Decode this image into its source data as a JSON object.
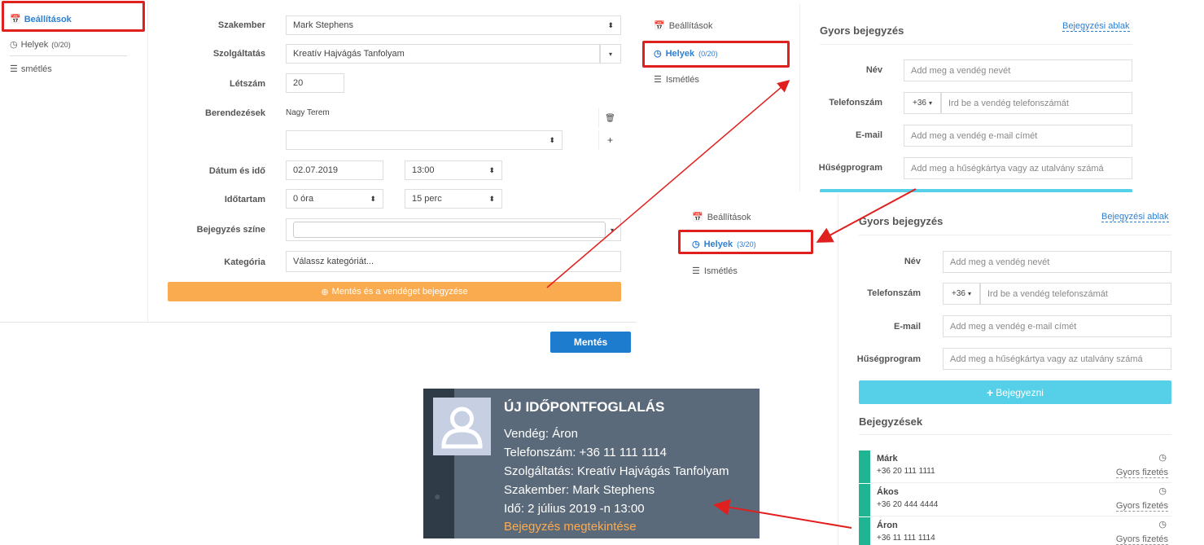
{
  "sidebar": {
    "items": [
      {
        "label": "Beállítások",
        "icon": "calendar-icon"
      },
      {
        "label": "Helyek",
        "count": "(0/20)",
        "icon": "clock-icon"
      },
      {
        "label": "smétlés",
        "icon": "list-icon"
      }
    ]
  },
  "form": {
    "fields": {
      "specialist": {
        "label": "Szakember",
        "value": "Mark Stephens"
      },
      "service": {
        "label": "Szolgáltatás",
        "value": "Kreatív Hajvágás Tanfolyam"
      },
      "headcount": {
        "label": "Létszám",
        "value": "20"
      },
      "equipment": {
        "label": "Berendezések",
        "value": "Nagy Terem",
        "select_value": ""
      },
      "datetime": {
        "label": "Dátum és idő",
        "date": "02.07.2019",
        "time": "13:00"
      },
      "duration": {
        "label": "Időtartam",
        "hours": "0 óra",
        "minutes": "15 perc"
      },
      "color": {
        "label": "Bejegyzés színe",
        "value": ""
      },
      "category": {
        "label": "Kategória",
        "value": "Válassz kategóriát..."
      }
    },
    "save_guest_button": "Mentés és a vendéget bejegyzése",
    "save_button": "Mentés"
  },
  "tabs_top": [
    {
      "label": "Beállítások"
    },
    {
      "label": "Helyek",
      "count": "(0/20)"
    },
    {
      "label": "Ismétlés"
    }
  ],
  "tabs_bottom": [
    {
      "label": "Beállítások"
    },
    {
      "label": "Helyek",
      "count": "(3/20)"
    },
    {
      "label": "Ismétlés"
    }
  ],
  "quick_top": {
    "title": "Gyors bejegyzés",
    "link": "Bejegyzési ablak",
    "name_label": "Név",
    "name_placeholder": "Add meg a vendég nevét",
    "phone_label": "Telefonszám",
    "country_code": "+36",
    "phone_placeholder": "Ird be a vendég telefonszámát",
    "email_label": "E-mail",
    "email_placeholder": "Add meg a vendég e-mail címét",
    "loyalty_label": "Hűségprogram",
    "loyalty_placeholder": "Add meg a hűségkártya vagy az utalvány számá"
  },
  "quick_bottom": {
    "title": "Gyors bejegyzés",
    "link": "Bejegyzési ablak",
    "name_label": "Név",
    "name_placeholder": "Add meg a vendég nevét",
    "phone_label": "Telefonszám",
    "country_code": "+36",
    "phone_placeholder": "Ird be a vendég telefonszámát",
    "email_label": "E-mail",
    "email_placeholder": "Add meg a vendég e-mail címét",
    "loyalty_label": "Hűségprogram",
    "loyalty_placeholder": "Add meg a hűségkártya vagy az utalvány számá",
    "submit": "Bejegyezni",
    "list_title": "Bejegyzések",
    "reservations": [
      {
        "name": "Márk",
        "phone": "+36 20 111 1111",
        "action": "Gyors fizetés"
      },
      {
        "name": "Ákos",
        "phone": "+36 20 444 4444",
        "action": "Gyors fizetés"
      },
      {
        "name": "Áron",
        "phone": "+36 11 111 1114",
        "action": "Gyors fizetés"
      }
    ]
  },
  "notification": {
    "title": "ÚJ IDŐPONTFOGLALÁS",
    "guest": "Vendég: Áron",
    "phone": "Telefonszám: +36 11 111 1114",
    "service": "Szolgáltatás: Kreatív Hajvágás Tanfolyam",
    "specialist": "Szakember: Mark Stephens",
    "time": "Idő: 2 július 2019 -n 13:00",
    "link": "Bejegyzés megtekintése"
  },
  "colors": {
    "accent_blue": "#2d7fd1",
    "orange": "#fbab4f",
    "highlight_red": "#e0201e",
    "teal": "#20b592",
    "cyan": "#55d0e8"
  }
}
